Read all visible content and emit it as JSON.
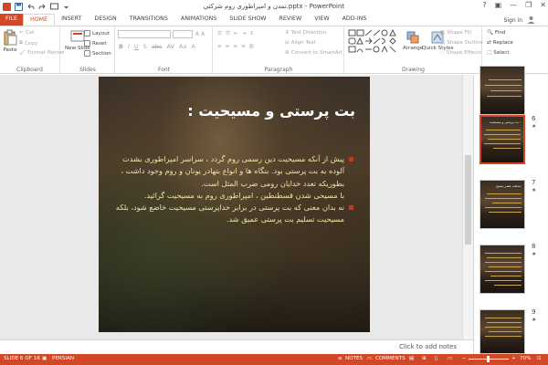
{
  "window": {
    "title": "تمدن و امپراطوری روم شرکتی.pptx - PowerPoint",
    "help": "?",
    "minimize": "—",
    "restore": "❐",
    "close": "✕",
    "signin": "Sign in"
  },
  "tabs": [
    "FILE",
    "HOME",
    "INSERT",
    "DESIGN",
    "TRANSITIONS",
    "ANIMATIONS",
    "SLIDE SHOW",
    "REVIEW",
    "VIEW",
    "ADD-INS"
  ],
  "active_tab": "HOME",
  "ribbon": {
    "clipboard": {
      "label": "Clipboard",
      "paste": "Paste",
      "cut": "Cut",
      "copy": "Copy",
      "format_painter": "Format Painter"
    },
    "slides": {
      "label": "Slides",
      "new_slide": "New Slide",
      "layout": "Layout",
      "reset": "Reset",
      "section": "Section"
    },
    "font": {
      "label": "Font"
    },
    "paragraph": {
      "label": "Paragraph",
      "text_direction": "Text Direction",
      "align_text": "Align Text",
      "convert_smartart": "Convert to SmartArt"
    },
    "drawing": {
      "label": "Drawing",
      "arrange": "Arrange",
      "quick_styles": "Quick Styles",
      "shape_fill": "Shape Fill",
      "shape_outline": "Shape Outline",
      "shape_effects": "Shape Effects"
    },
    "editing": {
      "label": "Editing",
      "find": "Find",
      "replace": "Replace",
      "select": "Select"
    }
  },
  "slide": {
    "title": "بت پرستی و مسیحیت :",
    "paragraphs": [
      {
        "text": "پیش از آنکه مسیحیت دین رسمی روم گردد ، سراسر امپراطوری بشدت آلوده به بت پرستی بود. بنگاه ها و انواع بتهادر یونان و روم وجود داشت ، بطوریکه تعدد خدایان رومی ضرب المثل است.",
        "bullet": true
      },
      {
        "text": "با مسیحی شدن قسطنطین ، امپراطوری روم به مسیحیت گرائید.",
        "bullet": false
      },
      {
        "text": "نه بدان معنی که بت پرستی در برابر خداپرستی مسیحیت خاضع شود، بلکه مسیحیت تسلیم بت پرستی عمیق شد.",
        "bullet": true
      }
    ]
  },
  "thumbnails": [
    {
      "num": "",
      "title": ""
    },
    {
      "num": "6",
      "title": "بت پرستی و مسیحیت :"
    },
    {
      "num": "7",
      "title": "مذهب عصر مسیح:"
    },
    {
      "num": "8",
      "title": ""
    },
    {
      "num": "9",
      "title": ""
    }
  ],
  "notes_placeholder": "Click to add notes",
  "status": {
    "slide": "SLIDE 6 OF 16",
    "language": "PERSIAN",
    "notes": "NOTES",
    "comments": "COMMENTS",
    "zoom": "70%",
    "zoom_minus": "−",
    "zoom_plus": "+"
  }
}
